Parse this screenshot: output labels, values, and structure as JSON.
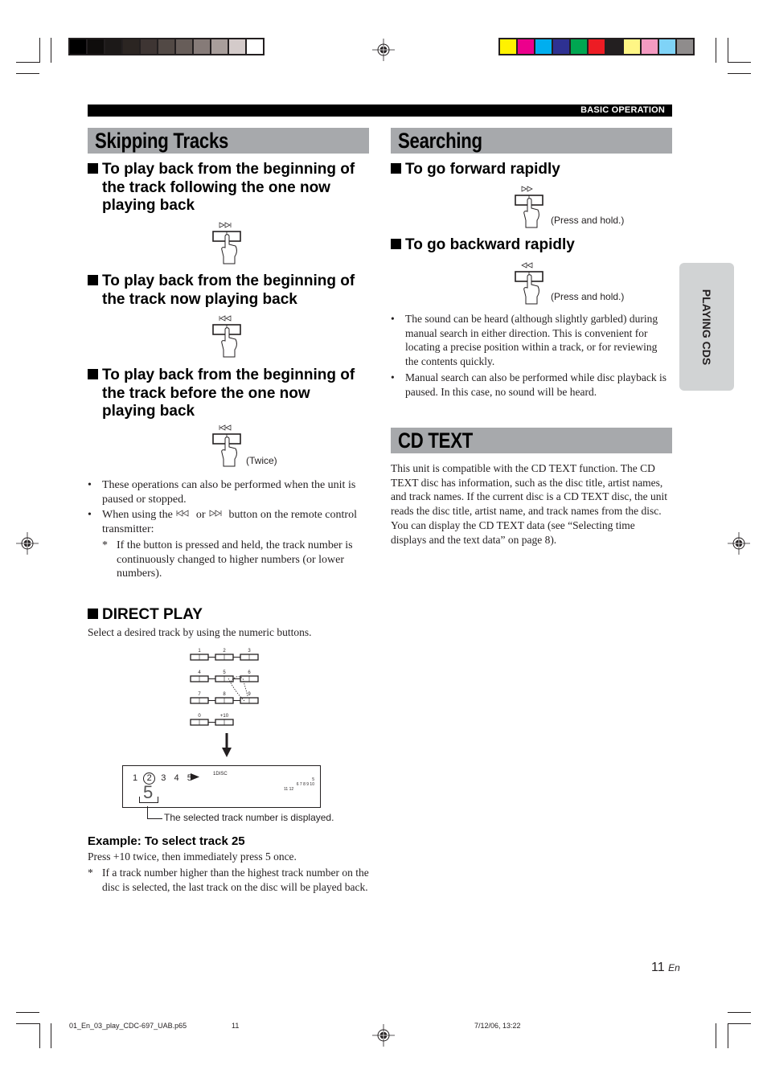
{
  "header": {
    "section_label": "BASIC OPERATION",
    "side_tab": "PLAYING CDS"
  },
  "print_marks": {
    "grayscale_swatches": [
      "#000000",
      "#0f0d0c",
      "#1c1918",
      "#2b2522",
      "#3e3533",
      "#524945",
      "#675d59",
      "#867b78",
      "#a89e9b",
      "#d4cbca",
      "#ffffff"
    ],
    "color_swatches": [
      "#fff200",
      "#ec008c",
      "#00aeef",
      "#2e3192",
      "#00a651",
      "#ed1c24",
      "#231f20",
      "#fff685",
      "#f49ac1",
      "#7fd3f7",
      "#8f8c8c"
    ],
    "footer_file": "01_En_03_play_CDC-697_UAB.p65",
    "footer_page": "11",
    "footer_date": "7/12/06, 13:22"
  },
  "skipping": {
    "title": "Skipping Tracks",
    "items": [
      {
        "heading_line1": "To play back from the beginning of",
        "heading_line2": "the track following the one now",
        "heading_line3": "playing back",
        "button_symbol": "next-track-icon"
      },
      {
        "heading_line1": "To play back from the beginning of",
        "heading_line2": "the track now playing back",
        "button_symbol": "prev-track-icon"
      },
      {
        "heading_line1": "To play back from the beginning of",
        "heading_line2": "the track before the one now",
        "heading_line3": "playing back",
        "button_symbol": "prev-track-icon",
        "note": "(Twice)"
      }
    ],
    "notes": {
      "bullet1": "These operations can also be performed when the unit is paused or stopped.",
      "bullet2_pre": "When using the ",
      "bullet2_or": " or ",
      "bullet2_post": " button on the remote control transmitter:",
      "star_mark": "*",
      "star": "If the button is pressed and held, the track number is continuously changed to higher numbers (or lower numbers)."
    }
  },
  "direct_play": {
    "heading": "DIRECT PLAY",
    "intro": "Select a desired track by using the numeric buttons.",
    "keypad_labels": [
      "1",
      "2",
      "3",
      "4",
      "5",
      "6",
      "7",
      "8",
      "9",
      "0",
      "+10"
    ],
    "display": {
      "tracks": [
        "1",
        "2",
        "3",
        "4",
        "5"
      ],
      "selected_track": "2",
      "disc_label": "1DISC",
      "big_digit": "5",
      "mini_row1": "5",
      "mini_row2": "6  7  8  9  10",
      "mini_row3": "11 12"
    },
    "callout": "The selected track number is displayed.",
    "example_heading": "Example: To select track 25",
    "example_text": "Press +10 twice, then immediately press 5 once.",
    "star_mark": "*",
    "example_note": "If a track number higher than the highest track number on the disc is selected, the last track on the disc will be played back."
  },
  "searching": {
    "title": "Searching",
    "forward_heading": "To go forward rapidly",
    "forward_note": "(Press and hold.)",
    "backward_heading": "To go backward rapidly",
    "backward_note": "(Press and hold.)",
    "bullets": [
      "The sound can be heard (although slightly garbled) during manual search in either direction. This is convenient for locating a precise position within a track, or for reviewing the contents quickly.",
      "Manual search can also be performed while disc playback is paused. In this case, no sound will be heard."
    ]
  },
  "cd_text": {
    "title": "CD TEXT",
    "body": "This unit is compatible with the CD TEXT function. The CD TEXT disc has information, such as the disc title, artist names, and track names. If the current disc is a CD TEXT disc, the unit reads the disc title, artist name, and track names from the disc. You can display the CD TEXT data (see “Selecting time displays and the text data” on page 8)."
  },
  "page": {
    "number": "11",
    "lang": "En"
  }
}
